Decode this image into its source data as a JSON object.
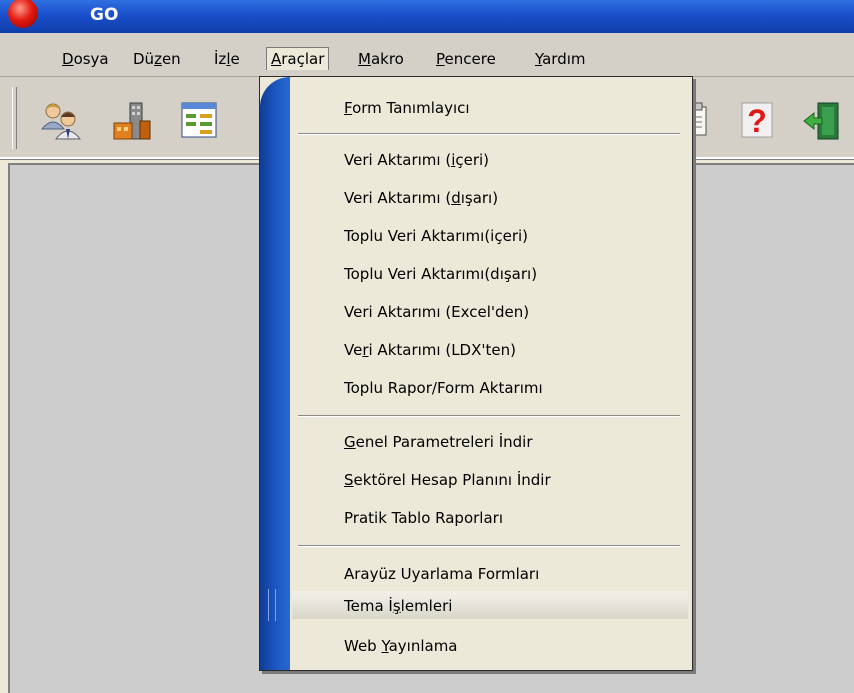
{
  "window": {
    "title": "GO"
  },
  "menubar": {
    "items": [
      {
        "pre": "",
        "u": "D",
        "post": "osya"
      },
      {
        "pre": "Dü",
        "u": "z",
        "post": "en"
      },
      {
        "pre": "İz",
        "u": "l",
        "post": "e"
      },
      {
        "pre": "",
        "u": "A",
        "post": "raçlar"
      },
      {
        "pre": "",
        "u": "M",
        "post": "akro"
      },
      {
        "pre": "",
        "u": "P",
        "post": "encere"
      },
      {
        "pre": "",
        "u": "Y",
        "post": "ardım"
      }
    ]
  },
  "toolbar": {
    "icons": [
      "users-icon",
      "buildings-icon",
      "form-window-icon",
      "document-icon",
      "help-icon",
      "exit-door-icon"
    ]
  },
  "dropdown": {
    "items": [
      {
        "pre": "",
        "u": "F",
        "post": "orm Tanımlayıcı"
      },
      {
        "pre": "Veri Aktarımı (",
        "u": "i",
        "post": "çeri)"
      },
      {
        "pre": "Veri Aktarımı (",
        "u": "d",
        "post": "ışarı)"
      },
      {
        "pre": "Toplu Veri Aktarımı(içeri)",
        "u": "",
        "post": ""
      },
      {
        "pre": "Toplu Veri Aktarımı(dışarı)",
        "u": "",
        "post": ""
      },
      {
        "pre": "Veri Aktarımı (Excel'den)",
        "u": "",
        "post": ""
      },
      {
        "pre": "Ve",
        "u": "r",
        "post": "i Aktarımı (LDX'ten)"
      },
      {
        "pre": "Toplu Rapor/Form Aktarımı",
        "u": "",
        "post": ""
      },
      {
        "pre": "",
        "u": "G",
        "post": "enel Parametreleri İndir"
      },
      {
        "pre": "",
        "u": "S",
        "post": "ektörel Hesap Planını İndir"
      },
      {
        "pre": "Pratik Tablo Raporları",
        "u": "",
        "post": ""
      },
      {
        "pre": "Arayüz Uyarlama Formları",
        "u": "",
        "post": ""
      },
      {
        "pre": "Tema İ",
        "u": "ş",
        "post": "lemleri"
      },
      {
        "pre": "Web ",
        "u": "Y",
        "post": "ayınlama"
      }
    ],
    "hovered_index": 12
  }
}
